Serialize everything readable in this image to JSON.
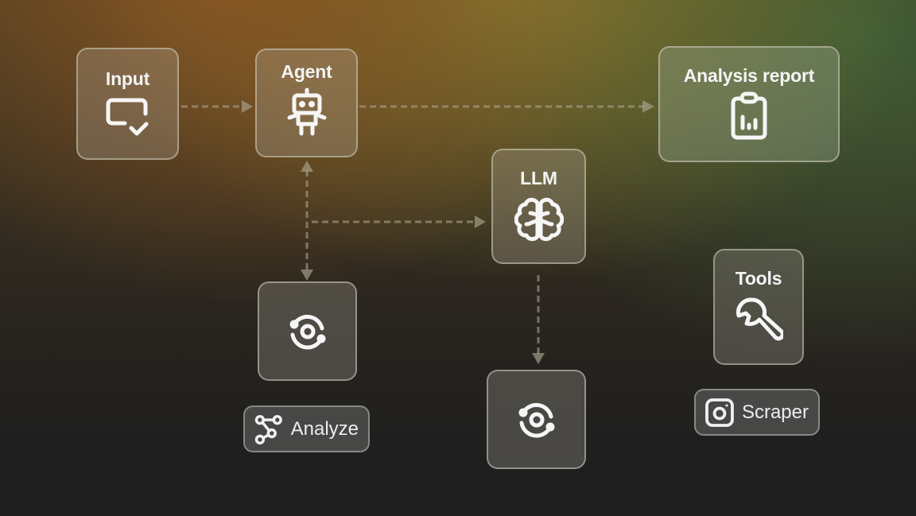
{
  "diagram": {
    "nodes": {
      "input": {
        "label": "Input",
        "icon": "input-check-icon"
      },
      "agent": {
        "label": "Agent",
        "icon": "robot-icon"
      },
      "report": {
        "label": "Analysis report",
        "icon": "clipboard-chart-icon"
      },
      "llm": {
        "label": "LLM",
        "icon": "brain-icon"
      },
      "process_left": {
        "label": "",
        "icon": "sync-orbit-icon"
      },
      "process_bottom": {
        "label": "",
        "icon": "sync-orbit-icon"
      },
      "tools": {
        "label": "Tools",
        "icon": "wrench-icon"
      }
    },
    "tags": {
      "analyze": {
        "label": "Analyze",
        "icon": "nodes-graph-icon"
      },
      "scraper": {
        "label": "Scraper",
        "icon": "instagram-icon"
      }
    },
    "edges": [
      {
        "from": "Input",
        "to": "Agent",
        "style": "dashed",
        "direction": "forward"
      },
      {
        "from": "Agent",
        "to": "Analysis report",
        "style": "dashed",
        "direction": "forward"
      },
      {
        "from": "Agent",
        "to": "process_left",
        "style": "dashed",
        "direction": "bidirectional"
      },
      {
        "from": "Agent-process branch",
        "to": "LLM",
        "style": "dashed",
        "direction": "forward"
      },
      {
        "from": "LLM",
        "to": "process_bottom",
        "style": "dashed",
        "direction": "forward"
      }
    ]
  }
}
